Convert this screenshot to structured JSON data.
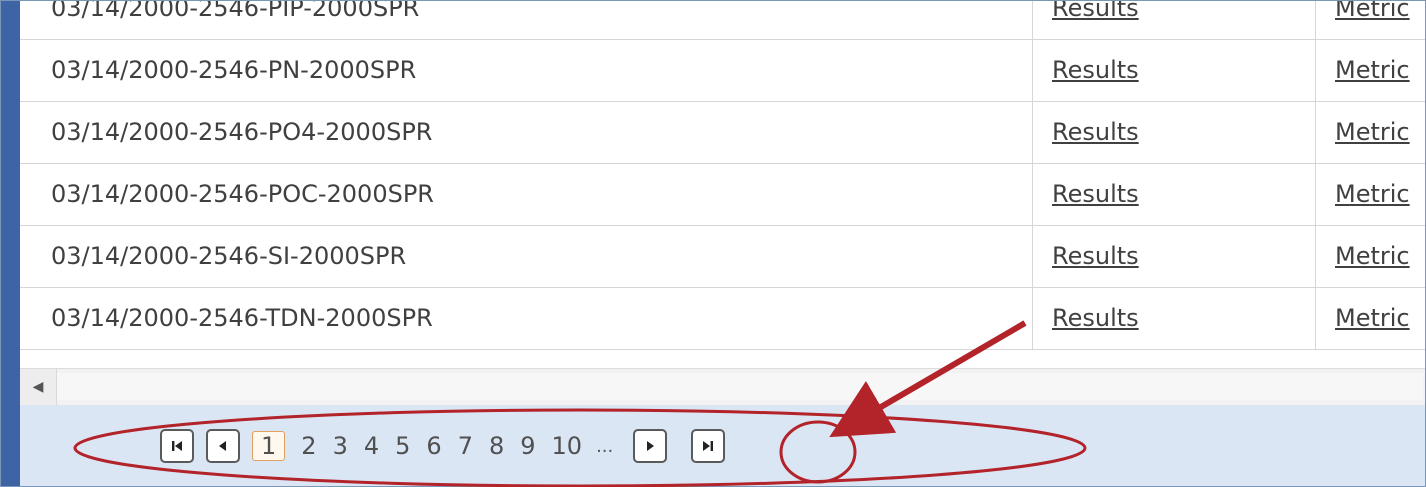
{
  "rows": [
    {
      "name": "03/14/2000-2546-PIP-2000SPR",
      "results": "Results",
      "metrics": "Metric"
    },
    {
      "name": "03/14/2000-2546-PN-2000SPR",
      "results": "Results",
      "metrics": "Metric"
    },
    {
      "name": "03/14/2000-2546-PO4-2000SPR",
      "results": "Results",
      "metrics": "Metric"
    },
    {
      "name": "03/14/2000-2546-POC-2000SPR",
      "results": "Results",
      "metrics": "Metric"
    },
    {
      "name": "03/14/2000-2546-SI-2000SPR",
      "results": "Results",
      "metrics": "Metric"
    },
    {
      "name": "03/14/2000-2546-TDN-2000SPR",
      "results": "Results",
      "metrics": "Metric"
    }
  ],
  "pager": {
    "pages": [
      "1",
      "2",
      "3",
      "4",
      "5",
      "6",
      "7",
      "8",
      "9",
      "10"
    ],
    "current": "1",
    "ellipsis": "...",
    "icons": {
      "first": "first-page-icon",
      "prev": "previous-page-icon",
      "next": "next-page-icon",
      "last": "last-page-icon"
    }
  },
  "annotation": {
    "color": "#b3232a"
  }
}
